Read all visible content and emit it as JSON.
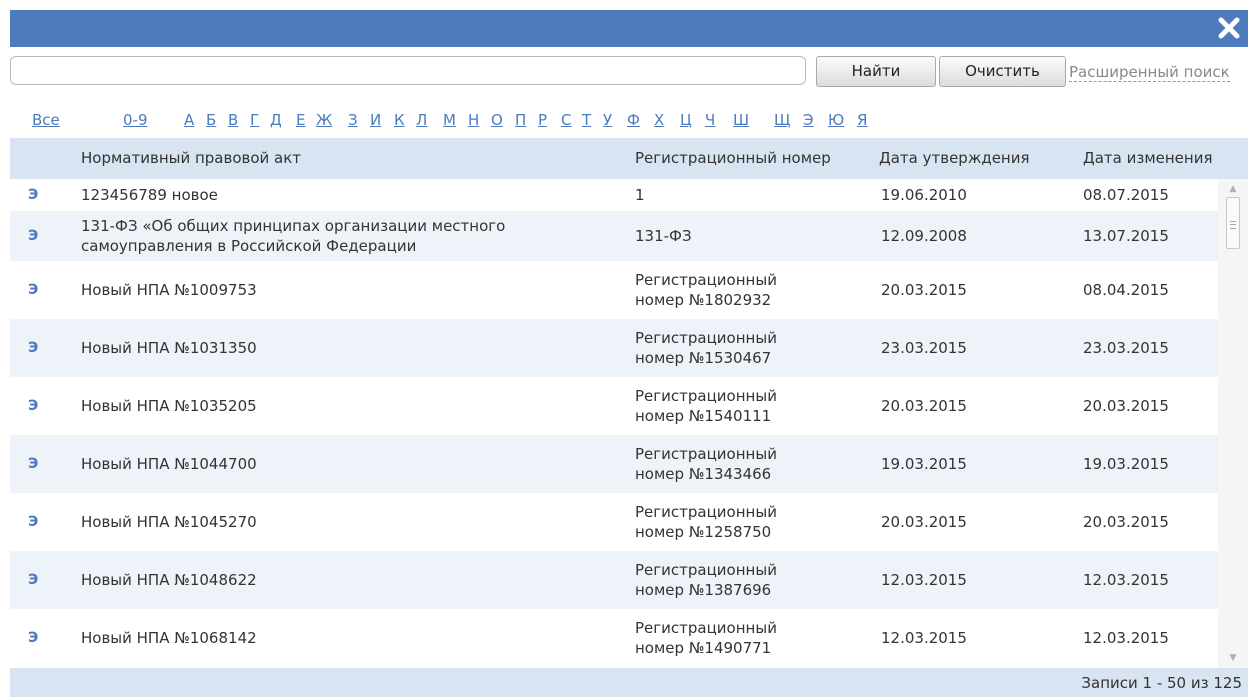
{
  "search": {
    "value": "",
    "find_label": "Найти",
    "clear_label": "Очистить",
    "advanced_label": "Расширенный поиск"
  },
  "alphabet": {
    "all": "Все",
    "digits": "0-9",
    "letters": [
      "А",
      "Б",
      "В",
      "Г",
      "Д",
      "Е",
      "Ж",
      "З",
      "И",
      "К",
      "Л",
      "М",
      "Н",
      "О",
      "П",
      "Р",
      "С",
      "Т",
      "У",
      "Ф",
      "Х",
      "Ц",
      "Ч",
      "Ш",
      "Щ",
      "Э",
      "Ю",
      "Я"
    ]
  },
  "table": {
    "headers": {
      "act": "Нормативный правовой акт",
      "reg_number": "Регистрационный номер",
      "approved": "Дата утверждения",
      "changed": "Дата изменения"
    },
    "rows": [
      {
        "mark": "Э",
        "name": "123456789 новое",
        "reg": "1",
        "approved": "19.06.2010",
        "changed": "08.07.2015"
      },
      {
        "mark": "Э",
        "name": "131-ФЗ «Об общих принципах организации местного самоуправления в Российской Федерации",
        "reg": "131-ФЗ",
        "approved": "12.09.2008",
        "changed": "13.07.2015"
      },
      {
        "mark": "Э",
        "name": "Новый НПА №1009753",
        "reg": "Регистрационный номер №1802932",
        "approved": "20.03.2015",
        "changed": "08.04.2015"
      },
      {
        "mark": "Э",
        "name": "Новый НПА №1031350",
        "reg": "Регистрационный номер №1530467",
        "approved": "23.03.2015",
        "changed": "23.03.2015"
      },
      {
        "mark": "Э",
        "name": "Новый НПА №1035205",
        "reg": "Регистрационный номер №1540111",
        "approved": "20.03.2015",
        "changed": "20.03.2015"
      },
      {
        "mark": "Э",
        "name": "Новый НПА №1044700",
        "reg": "Регистрационный номер №1343466",
        "approved": "19.03.2015",
        "changed": "19.03.2015"
      },
      {
        "mark": "Э",
        "name": "Новый НПА №1045270",
        "reg": "Регистрационный номер №1258750",
        "approved": "20.03.2015",
        "changed": "20.03.2015"
      },
      {
        "mark": "Э",
        "name": "Новый НПА №1048622",
        "reg": "Регистрационный номер №1387696",
        "approved": "12.03.2015",
        "changed": "12.03.2015"
      },
      {
        "mark": "Э",
        "name": "Новый НПА №1068142",
        "reg": "Регистрационный номер №1490771",
        "approved": "12.03.2015",
        "changed": "12.03.2015"
      }
    ]
  },
  "footer": {
    "records": "Записи 1 - 50 из 125"
  },
  "colors": {
    "accent": "#4d7bbd",
    "header_bg": "#d8e4f2",
    "alt_row_bg": "#eef3f9"
  }
}
